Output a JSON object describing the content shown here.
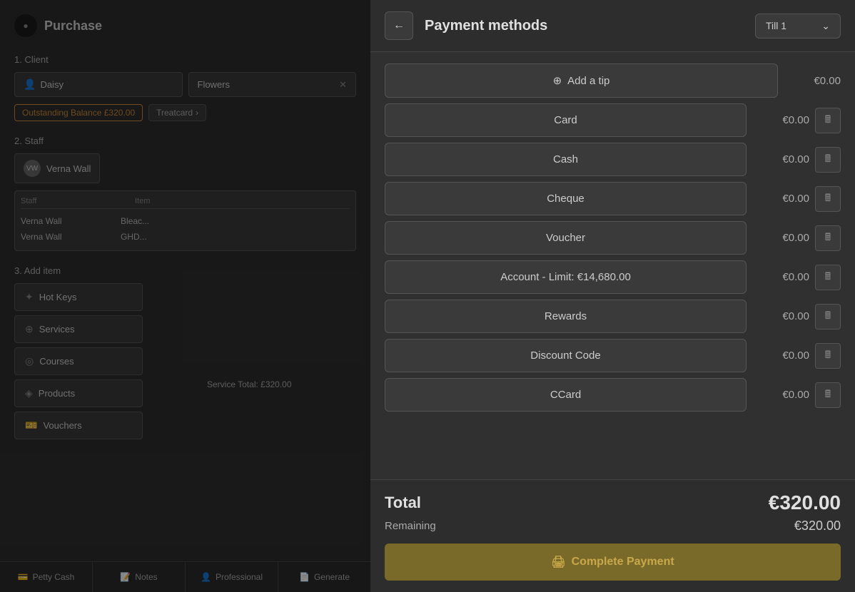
{
  "app": {
    "title": "Purchase"
  },
  "left": {
    "section_client": "1. Client",
    "section_staff": "2. Staff",
    "section_add_item": "3. Add item",
    "client_name": "Daisy",
    "client_flowers": "Flowers",
    "badge_balance": "Outstanding Balance £320.00",
    "badge_treatcard": "Treatcard",
    "staff_name": "Verna Wall",
    "staff_table_header_staff": "Staff",
    "staff_table_header_item": "Item",
    "staff_row1_staff": "Verna Wall",
    "staff_row1_item": "Bleac...",
    "staff_row2_staff": "Verna Wall",
    "staff_row2_item": "GHD...",
    "service_total": "Service Total: £320.00",
    "btn_hot_keys": "Hot Keys",
    "btn_services": "Services",
    "btn_courses": "Courses",
    "btn_products": "Products",
    "btn_vouchers": "Vouchers",
    "bottom_tabs": [
      {
        "label": "Petty Cash",
        "icon": "💳"
      },
      {
        "label": "Notes",
        "icon": "📝"
      },
      {
        "label": "Professional",
        "icon": "👤"
      },
      {
        "label": "Generate",
        "icon": "📄"
      }
    ]
  },
  "payment": {
    "title": "Payment methods",
    "till": "Till 1",
    "add_tip_label": "Add a tip",
    "add_tip_icon": "⊕",
    "tip_amount": "€0.00",
    "methods": [
      {
        "label": "Card",
        "amount": "€0.00"
      },
      {
        "label": "Cash",
        "amount": "€0.00"
      },
      {
        "label": "Cheque",
        "amount": "€0.00"
      },
      {
        "label": "Voucher",
        "amount": "€0.00"
      },
      {
        "label": "Account - Limit: €14,680.00",
        "amount": "€0.00"
      },
      {
        "label": "Rewards",
        "amount": "€0.00"
      },
      {
        "label": "Discount Code",
        "amount": "€0.00"
      },
      {
        "label": "CCard",
        "amount": "€0.00"
      }
    ],
    "total_label": "Total",
    "total_amount": "€320.00",
    "remaining_label": "Remaining",
    "remaining_amount": "€320.00",
    "complete_btn_label": "Complete Payment",
    "complete_btn_icon": "🖨"
  }
}
